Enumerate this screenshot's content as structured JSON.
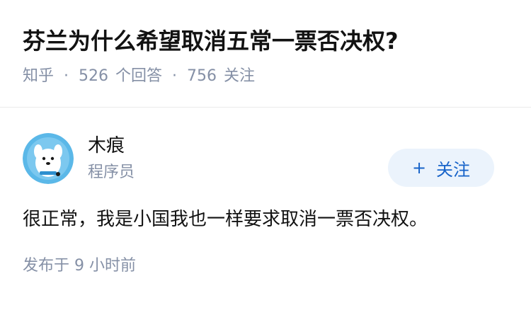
{
  "question": {
    "title": "芬兰为什么希望取消五常一票否决权?",
    "source": "知乎",
    "separator": "·",
    "answers_count": "526",
    "answers_label": "个回答",
    "follows_count": "756",
    "follows_label": "关注"
  },
  "answer": {
    "author_name": "木痕",
    "author_bio": "程序员",
    "follow_plus": "+",
    "follow_label": "关注",
    "content": "很正常，我是小国我也一样要求取消一票否决权。",
    "time": "发布于 9 小时前"
  },
  "colors": {
    "meta": "#8590a6",
    "follow_bg": "#ebf3fc",
    "follow_text": "#1763c9",
    "avatar_bg": "#5bb8e8"
  },
  "icons": {
    "avatar": "cartoon-dog-avatar"
  }
}
